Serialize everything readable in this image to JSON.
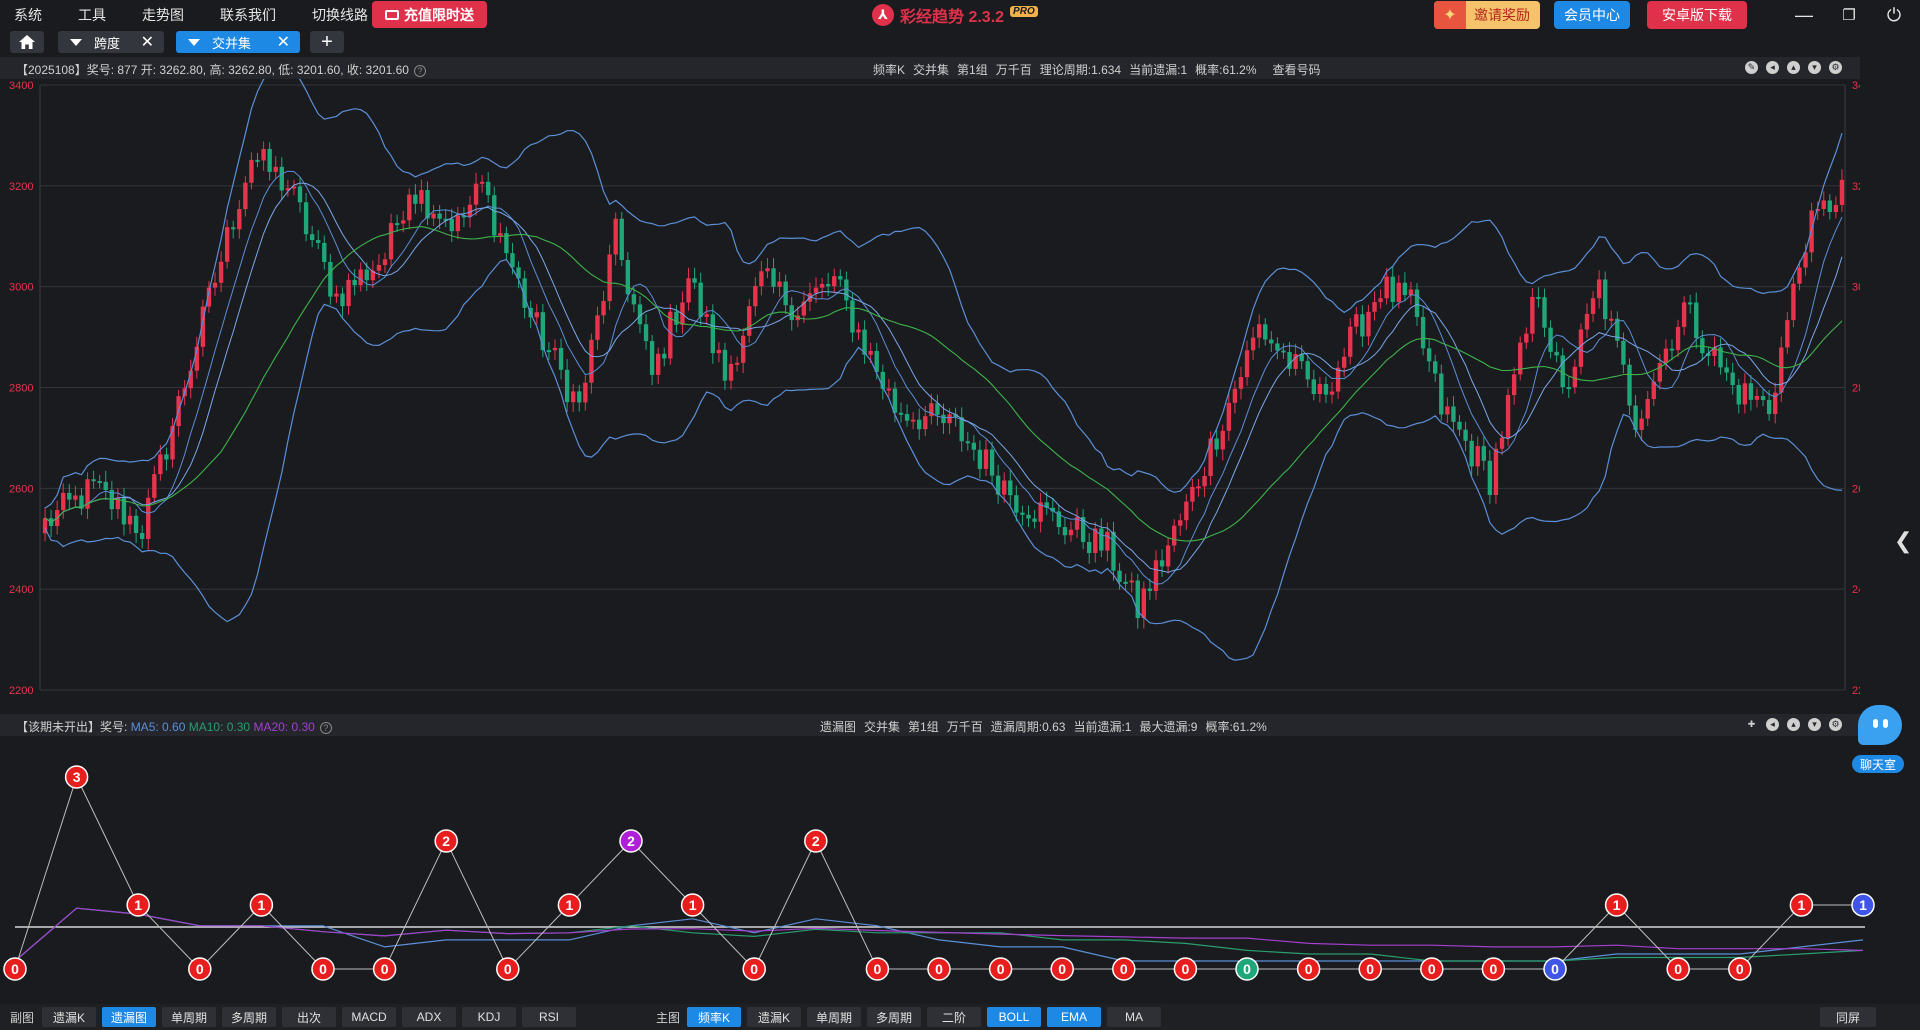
{
  "menu": [
    "系统",
    "工具",
    "走势图",
    "联系我们",
    "切换线路"
  ],
  "promo": {
    "label": "充值限时送"
  },
  "app": {
    "name": "彩经趋势 2.3.2",
    "badge": "PRO"
  },
  "header_buttons": {
    "invite": "邀请奖励",
    "member": "会员中心",
    "android": "安卓版下载"
  },
  "tabs": [
    {
      "label": "跨度"
    },
    {
      "label": "交并集"
    }
  ],
  "main_panel": {
    "info": "【2025108】奖号: 877  开: 3262.80, 高: 3262.80, 低: 3201.60, 收: 3201.60",
    "center": [
      "频率K",
      "交并集",
      "第1组",
      "万千百",
      "理论周期:1.634",
      "当前遗漏:1",
      "概率:61.2%",
      "查看号码"
    ]
  },
  "sub_panel": {
    "info_prefix": "【该期未开出】奖号:",
    "ma5": "MA5: 0.60",
    "ma10": "MA10: 0.30",
    "ma20": "MA20: 0.30",
    "center": [
      "遗漏图",
      "交并集",
      "第1组",
      "万千百",
      "遗漏周期:0.63",
      "当前遗漏:1",
      "最大遗漏:9",
      "概率:61.2%"
    ]
  },
  "chatroom": {
    "label": "聊天室"
  },
  "bottom": {
    "sub_label": "副图",
    "sub_buttons": [
      "遗漏K",
      "遗漏图",
      "单周期",
      "多周期",
      "出次",
      "MACD",
      "ADX",
      "KDJ",
      "RSI"
    ],
    "sub_active": 1,
    "main_label": "主图",
    "main_buttons": [
      "频率K",
      "遗漏K",
      "单周期",
      "多周期",
      "二阶",
      "BOLL",
      "EMA",
      "MA"
    ],
    "main_active": [
      0,
      5,
      6
    ],
    "fullscreen": "同屏"
  },
  "colors": {
    "up": "#e8334d",
    "down": "#1fa77a",
    "accent": "#1e88e5",
    "boll": "#5b8fd6",
    "ma20": "#3db34a",
    "ma10": "#2a9d6e",
    "ma_purple": "#a340d0"
  },
  "chart_data": [
    {
      "type": "candlestick",
      "y_axis": {
        "min": 2200,
        "max": 3400,
        "ticks": [
          2200,
          2400,
          2600,
          2800,
          3000,
          3200,
          3400
        ]
      },
      "keypoints": [
        [
          0,
          2530
        ],
        [
          8,
          2600
        ],
        [
          16,
          2520
        ],
        [
          34,
          3260
        ],
        [
          40,
          3200
        ],
        [
          48,
          2980
        ],
        [
          56,
          3060
        ],
        [
          60,
          3200
        ],
        [
          68,
          3120
        ],
        [
          72,
          3200
        ],
        [
          80,
          2940
        ],
        [
          88,
          2760
        ],
        [
          94,
          3100
        ],
        [
          100,
          2820
        ],
        [
          106,
          3020
        ],
        [
          112,
          2820
        ],
        [
          118,
          3010
        ],
        [
          124,
          2960
        ],
        [
          130,
          3010
        ],
        [
          140,
          2760
        ],
        [
          150,
          2720
        ],
        [
          160,
          2580
        ],
        [
          175,
          2480
        ],
        [
          180,
          2360
        ],
        [
          188,
          2560
        ],
        [
          200,
          2920
        ],
        [
          210,
          2780
        ],
        [
          220,
          3000
        ],
        [
          225,
          2960
        ],
        [
          230,
          2760
        ],
        [
          238,
          2620
        ],
        [
          246,
          3000
        ],
        [
          250,
          2780
        ],
        [
          256,
          3000
        ],
        [
          262,
          2740
        ],
        [
          270,
          2960
        ],
        [
          278,
          2800
        ],
        [
          284,
          2760
        ],
        [
          290,
          3100
        ],
        [
          296,
          3200
        ]
      ],
      "indicators": [
        "BOLL",
        "EMA",
        "MA"
      ]
    },
    {
      "type": "scatter",
      "points": [
        {
          "value": "0",
          "color": "red"
        },
        {
          "value": "3",
          "color": "red"
        },
        {
          "value": "1",
          "color": "red"
        },
        {
          "value": "0",
          "color": "red"
        },
        {
          "value": "1",
          "color": "red"
        },
        {
          "value": "0",
          "color": "red"
        },
        {
          "value": "0",
          "color": "red"
        },
        {
          "value": "2",
          "color": "red"
        },
        {
          "value": "0",
          "color": "red"
        },
        {
          "value": "1",
          "color": "red"
        },
        {
          "value": "2",
          "color": "purple"
        },
        {
          "value": "1",
          "color": "red"
        },
        {
          "value": "0",
          "color": "red"
        },
        {
          "value": "2",
          "color": "red"
        },
        {
          "value": "0",
          "color": "red"
        },
        {
          "value": "0",
          "color": "red"
        },
        {
          "value": "0",
          "color": "red"
        },
        {
          "value": "0",
          "color": "red"
        },
        {
          "value": "0",
          "color": "red"
        },
        {
          "value": "0",
          "color": "red"
        },
        {
          "value": "0",
          "color": "green"
        },
        {
          "value": "0",
          "color": "red"
        },
        {
          "value": "0",
          "color": "red"
        },
        {
          "value": "0",
          "color": "red"
        },
        {
          "value": "0",
          "color": "red"
        },
        {
          "value": "0",
          "color": "blue"
        },
        {
          "value": "1",
          "color": "red"
        },
        {
          "value": "0",
          "color": "red"
        },
        {
          "value": "0",
          "color": "red"
        },
        {
          "value": "1",
          "color": "red"
        },
        {
          "value": "1",
          "color": "blue"
        }
      ]
    }
  ]
}
